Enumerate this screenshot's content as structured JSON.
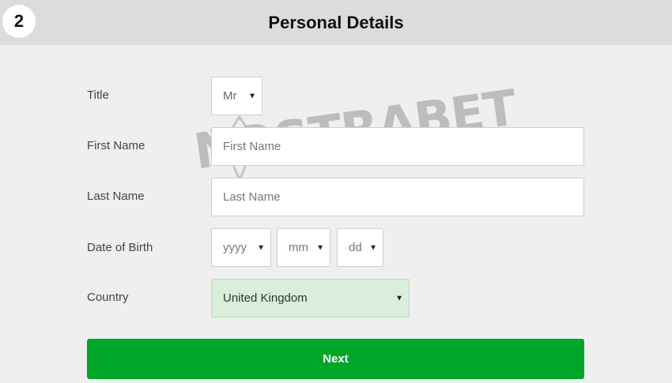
{
  "header": {
    "step_number": "2",
    "title": "Personal Details"
  },
  "form": {
    "title": {
      "label": "Title",
      "selected": "Mr"
    },
    "first_name": {
      "label": "First Name",
      "placeholder": "First Name"
    },
    "last_name": {
      "label": "Last Name",
      "placeholder": "Last Name"
    },
    "date_of_birth": {
      "label": "Date of Birth",
      "year_placeholder": "yyyy",
      "month_placeholder": "mm",
      "day_placeholder": "dd"
    },
    "country": {
      "label": "Country",
      "selected": "United Kingdom"
    }
  },
  "actions": {
    "next_label": "Next"
  },
  "watermark": {
    "text": "NOSTRABET"
  },
  "icons": {
    "dropdown": "caret-down-icon"
  },
  "colors": {
    "header_bg": "#dcdcdc",
    "page_bg": "#efefef",
    "primary_button": "#00a627",
    "country_field_bg": "#d9eedb"
  }
}
